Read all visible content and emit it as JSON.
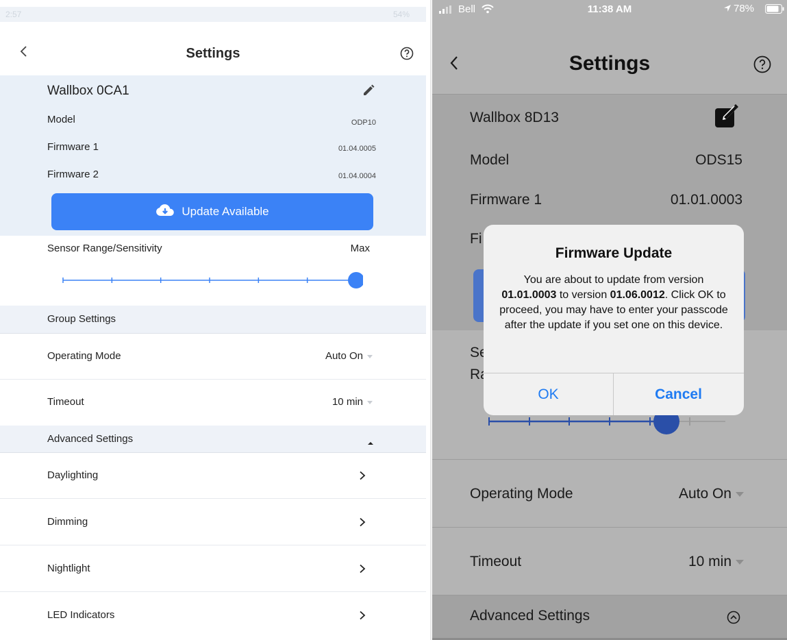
{
  "left": {
    "status": {
      "time": "2:57",
      "battery": "54%"
    },
    "header": {
      "title": "Settings"
    },
    "device": {
      "name": "Wallbox 0CA1",
      "model_label": "Model",
      "model_value": "ODP10",
      "fw1_label": "Firmware 1",
      "fw1_value": "01.04.0005",
      "fw2_label": "Firmware 2",
      "fw2_value": "01.04.0004",
      "update_button": "Update Available"
    },
    "sensor": {
      "label": "Sensor Range/Sensitivity",
      "value": "Max",
      "level": 1.0,
      "ticks": 7
    },
    "group_settings": "Group Settings",
    "operating_mode": {
      "label": "Operating Mode",
      "value": "Auto On"
    },
    "timeout": {
      "label": "Timeout",
      "value": "10 min"
    },
    "advanced_settings": "Advanced Settings",
    "advanced_items": [
      "Daylighting",
      "Dimming",
      "Nightlight",
      "LED Indicators"
    ]
  },
  "right": {
    "status": {
      "carrier": "Bell",
      "time": "11:38 AM",
      "battery": "78%"
    },
    "header": {
      "title": "Settings"
    },
    "device": {
      "name": "Wallbox 8D13",
      "model_label": "Model",
      "model_value": "ODS15",
      "fw1_label": "Firmware 1",
      "fw1_value": "01.01.0003",
      "fw2_label_partial": "Fi",
      "sensor_partial_1": "Se",
      "sensor_partial_2": "Ra"
    },
    "operating_mode": {
      "label": "Operating Mode",
      "value": "Auto On"
    },
    "timeout": {
      "label": "Timeout",
      "value": "10 min"
    },
    "advanced_settings": "Advanced Settings",
    "dialog": {
      "title": "Firmware Update",
      "msg_1": "You are about to update from version",
      "from_version": "01.01.0003",
      "msg_2": " to version ",
      "to_version": "01.06.0012",
      "msg_3": ".",
      "msg_4": "Click OK to proceed, you may have to enter your passcode after the update if you set one on this device.",
      "ok": "OK",
      "cancel": "Cancel"
    }
  },
  "colors": {
    "accent": "#3b82f6",
    "ios_blue": "#1f7bf2",
    "dialog_bg": "#f1f1f1",
    "dimmed_bg": "#b4b4b4"
  }
}
